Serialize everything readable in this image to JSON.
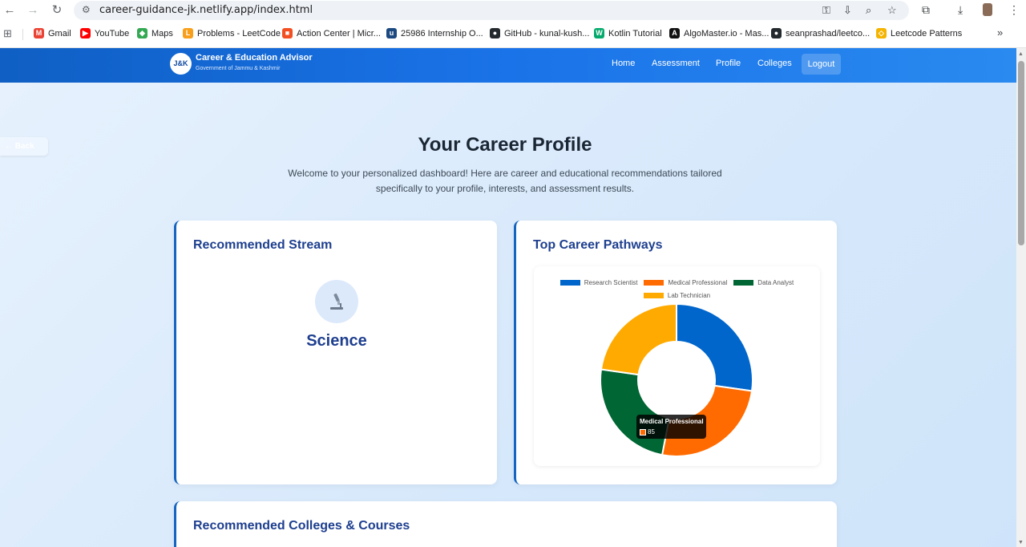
{
  "browser": {
    "url": "career-guidance-jk.netlify.app/index.html",
    "bookmarks": [
      {
        "label": "Gmail",
        "icon": "gmail-icon",
        "color": "#ea4335"
      },
      {
        "label": "YouTube",
        "icon": "youtube-icon",
        "color": "#ff0000"
      },
      {
        "label": "Maps",
        "icon": "maps-icon",
        "color": "#34a853"
      },
      {
        "label": "Problems - LeetCode",
        "icon": "leetcode-icon",
        "color": "#f89f1b"
      },
      {
        "label": "Action Center | Micr...",
        "icon": "microsoft-icon",
        "color": "#f25022"
      },
      {
        "label": "25986 Internship O...",
        "icon": "unstop-icon",
        "color": "#1c4980"
      },
      {
        "label": "GitHub - kunal-kush...",
        "icon": "github-icon",
        "color": "#24292e"
      },
      {
        "label": "Kotlin Tutorial",
        "icon": "w3schools-icon",
        "color": "#04aa6d"
      },
      {
        "label": "AlgoMaster.io - Mas...",
        "icon": "algomaster-icon",
        "color": "#111111"
      },
      {
        "label": "seanprashad/leetco...",
        "icon": "github-icon",
        "color": "#24292e"
      },
      {
        "label": "Leetcode Patterns",
        "icon": "leetcode-patterns-icon",
        "color": "#f5b400"
      }
    ]
  },
  "header": {
    "logo": "J&K",
    "title": "Career & Education Advisor",
    "subtitle": "Government of Jammu & Kashmir",
    "nav": [
      "Home",
      "Assessment",
      "Profile",
      "Colleges"
    ],
    "logout": "Logout"
  },
  "page": {
    "back": "← Back",
    "title": "Your Career Profile",
    "subtitle": "Welcome to your personalized dashboard! Here are career and educational recommendations tailored specifically to your profile, interests, and assessment results."
  },
  "stream_card": {
    "title": "Recommended Stream",
    "icon": "microscope-icon",
    "stream": "Science"
  },
  "career_card": {
    "title": "Top Career Pathways",
    "tooltip": {
      "title": "Medical Professional",
      "value": "85"
    }
  },
  "colleges_card": {
    "title": "Recommended Colleges & Courses"
  },
  "chart_data": {
    "type": "pie",
    "variant": "doughnut",
    "categories": [
      "Research Scientist",
      "Medical Professional",
      "Data Analyst",
      "Lab Technician"
    ],
    "values": [
      90,
      85,
      80,
      75
    ],
    "colors": [
      "#0066cc",
      "#ff6b00",
      "#006633",
      "#ffaa00"
    ],
    "legend_position": "top"
  }
}
